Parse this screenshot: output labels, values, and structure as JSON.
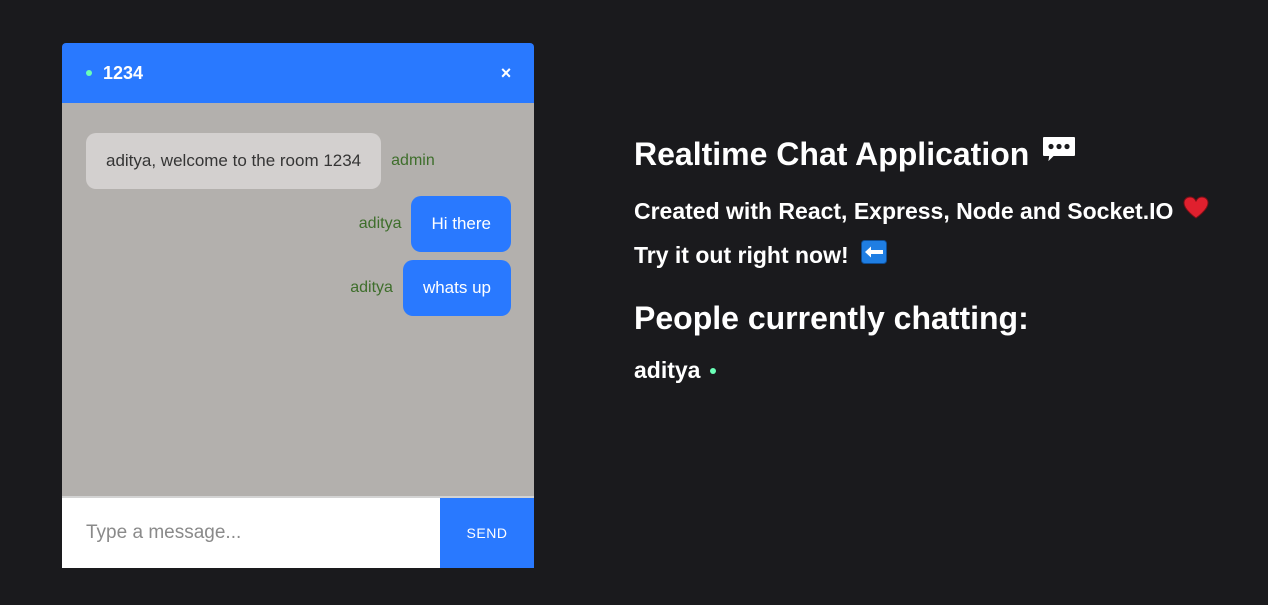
{
  "chat": {
    "room_name": "1234",
    "close_symbol": "×",
    "messages": [
      {
        "text": "aditya, welcome to the room 1234",
        "sender": "admin",
        "own": false
      },
      {
        "text": "Hi there",
        "sender": "aditya",
        "own": true
      },
      {
        "text": "whats up",
        "sender": "aditya",
        "own": true
      }
    ],
    "input": {
      "placeholder": "Type a message...",
      "value": ""
    },
    "send_label": "SEND"
  },
  "info": {
    "title": "Realtime Chat Application",
    "subtitle": "Created with React, Express, Node and Socket.IO",
    "cta": "Try it out right now!",
    "people_title": "People currently chatting:",
    "users": [
      "aditya"
    ]
  },
  "icons": {
    "speech_bubble": "speech-bubble-icon",
    "heart": "heart-icon",
    "left_arrow": "left-arrow-icon",
    "online": "online-dot-icon"
  },
  "colors": {
    "page_bg": "#1a1a1d",
    "accent": "#2979ff",
    "messages_bg": "#b3b0ad",
    "online": "#6affb7",
    "sender_text": "#3e6e2b"
  }
}
